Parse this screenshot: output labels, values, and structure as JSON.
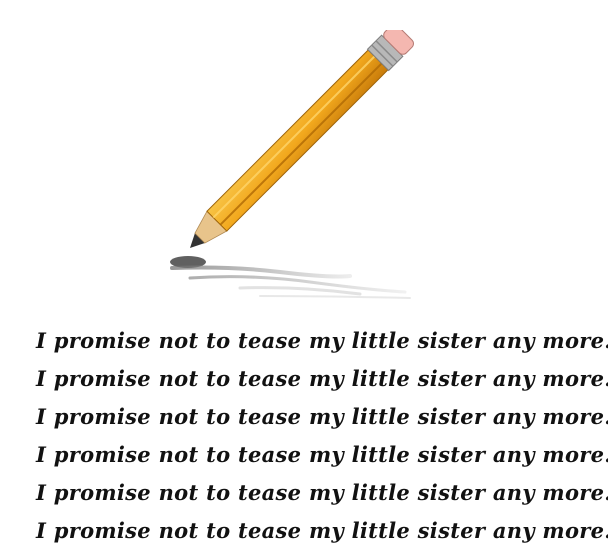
{
  "illustration": {
    "icon": "pencil-writing-icon",
    "colors": {
      "pencil_body": "#F2A81D",
      "pencil_dark": "#C77A0A",
      "ferrule": "#B8B8B8",
      "eraser": "#F4B7B0",
      "wood": "#E8C48B",
      "graphite": "#333333",
      "scribble": "#9A9A9A"
    }
  },
  "lines": [
    "I promise not to tease my little sister any more.",
    "I promise not to tease my little sister any more.",
    "I promise not to tease my little sister any more.",
    "I promise not to tease my little sister any more.",
    "I promise not to tease my little sister any more.",
    "I promise not to tease my little sister any more."
  ]
}
